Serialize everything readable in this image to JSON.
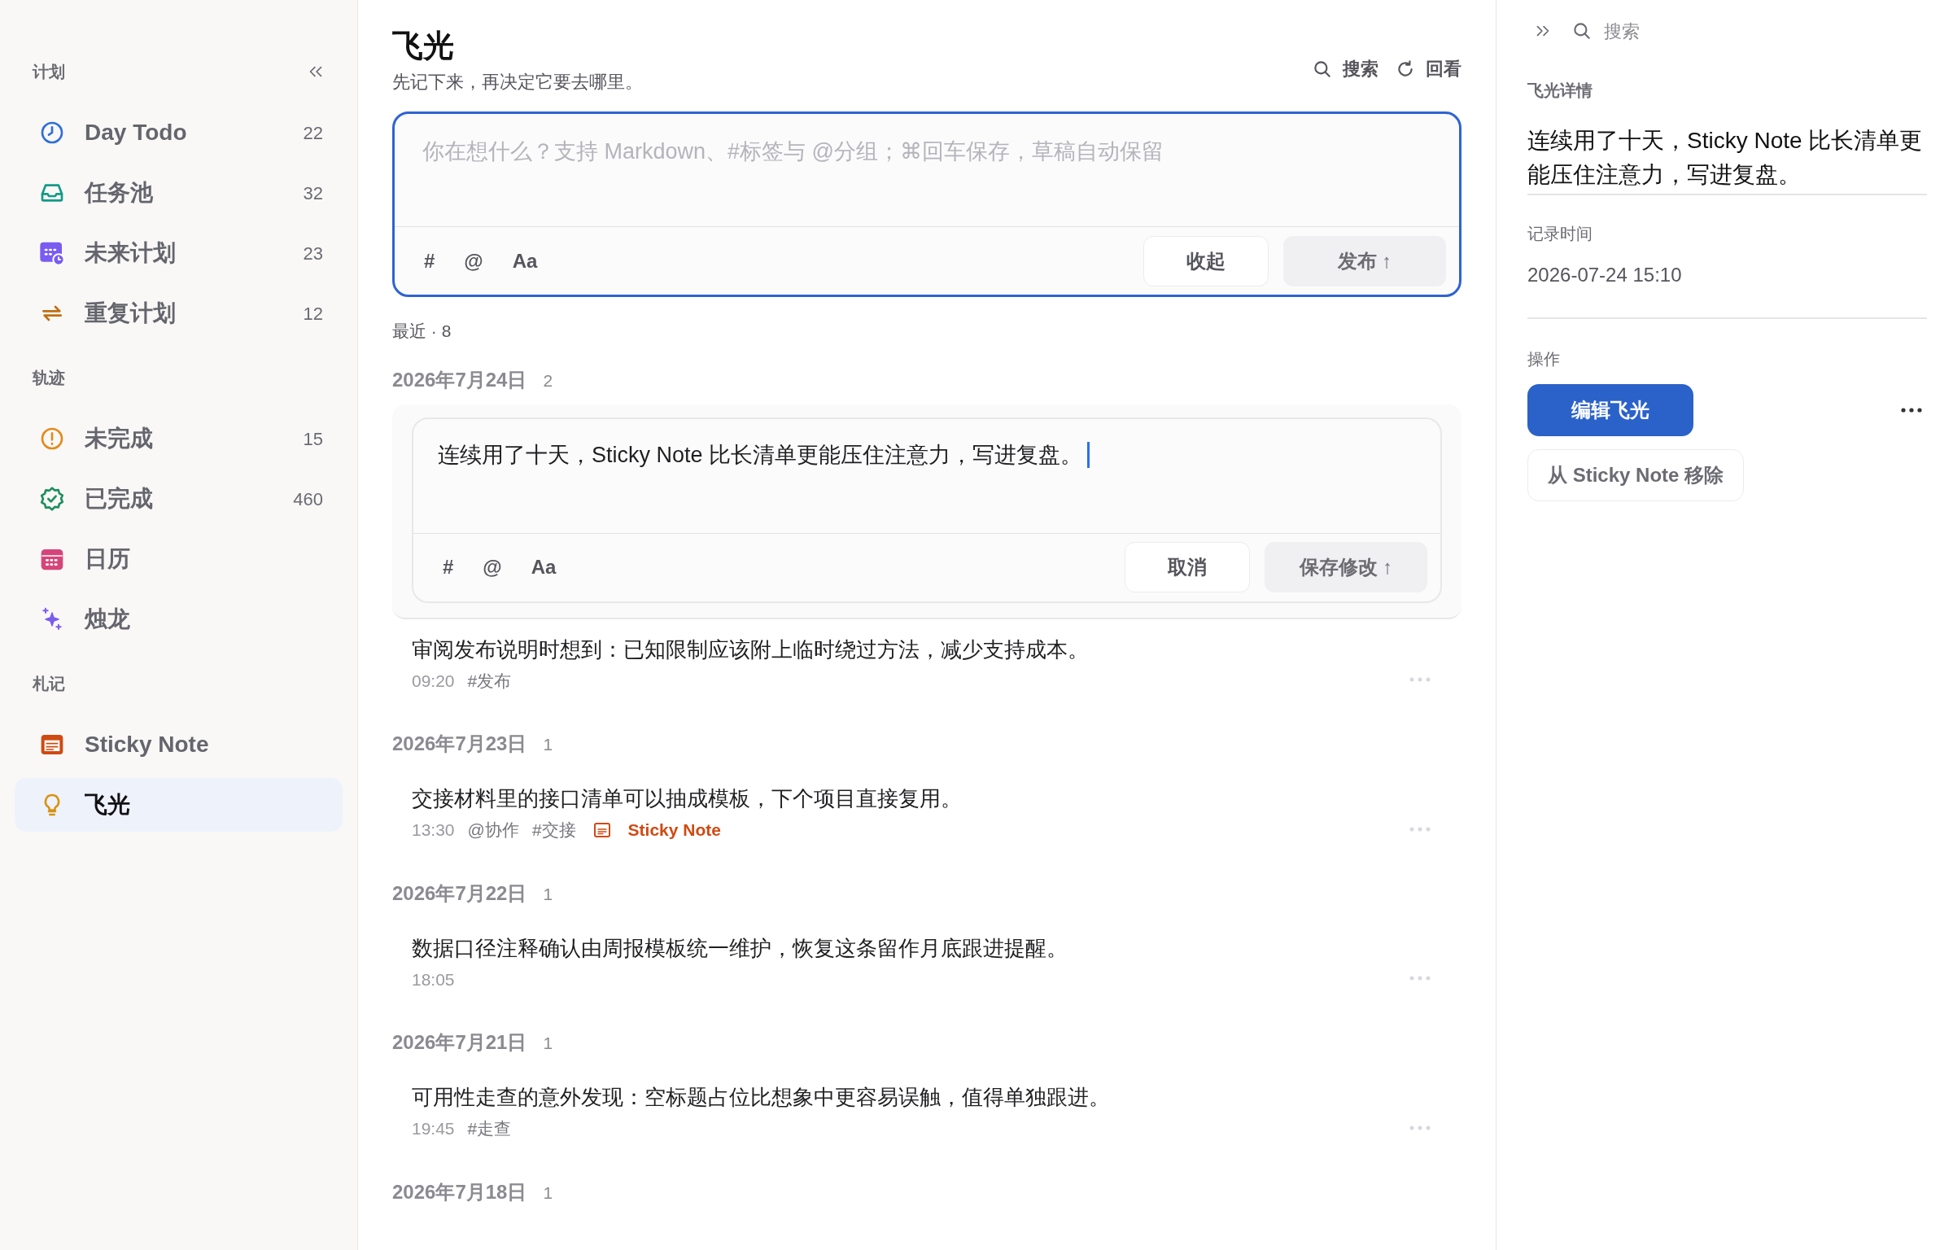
{
  "sidebar": {
    "sections": [
      {
        "title": "计划",
        "items": [
          {
            "kind": "clock",
            "label": "Day Todo",
            "count": "22",
            "selected": false
          },
          {
            "kind": "inbox",
            "label": "任务池",
            "count": "32",
            "selected": false
          },
          {
            "kind": "calendar-clock",
            "label": "未来计划",
            "count": "23",
            "selected": false
          },
          {
            "kind": "repeat",
            "label": "重复计划",
            "count": "12",
            "selected": false
          }
        ]
      },
      {
        "title": "轨迹",
        "items": [
          {
            "kind": "alert",
            "label": "未完成",
            "count": "15",
            "selected": false
          },
          {
            "kind": "badge-check",
            "label": "已完成",
            "count": "460",
            "selected": false
          },
          {
            "kind": "calendar",
            "label": "日历",
            "selected": false
          },
          {
            "kind": "sparkles",
            "label": "烛龙",
            "selected": false
          }
        ]
      },
      {
        "title": "札记",
        "items": [
          {
            "kind": "note",
            "label": "Sticky Note",
            "selected": false
          },
          {
            "kind": "bulb",
            "label": "飞光",
            "selected": true
          }
        ]
      }
    ]
  },
  "main": {
    "title": "飞光",
    "subtitle": "先记下来，再决定它要去哪里。",
    "actions": [
      {
        "kind": "search",
        "label": "搜索"
      },
      {
        "kind": "review",
        "label": "回看"
      }
    ],
    "composer": {
      "placeholder": "你在想什么？支持 Markdown、#标签与 @分组；⌘回车保存，草稿自动保留",
      "tools": [
        "#",
        "@",
        "Aa"
      ],
      "cancel": "收起",
      "submit": "发布 ↑"
    },
    "recent": "最近 · 8",
    "groups": [
      {
        "date": "2026年7月24日",
        "count": "2",
        "entries": [
          {
            "kind": "editor",
            "text": "连续用了十天，Sticky Note 比长清单更能压住注意力，写进复盘。",
            "tools": [
              "#",
              "@",
              "Aa"
            ],
            "cancel": "取消",
            "submit": "保存修改 ↑"
          },
          {
            "kind": "note",
            "text": "审阅发布说明时想到：已知限制应该附上临时绕过方法，减少支持成本。",
            "time": "09:20",
            "tags": [
              {
                "kind": "tag",
                "label": "#发布"
              }
            ]
          }
        ]
      },
      {
        "date": "2026年7月23日",
        "count": "1",
        "entries": [
          {
            "kind": "note",
            "text": "交接材料里的接口清单可以抽成模板，下个项目直接复用。",
            "time": "13:30",
            "tags": [
              {
                "kind": "tag",
                "label": "@协作"
              },
              {
                "kind": "tag",
                "label": "#交接"
              },
              {
                "kind": "link",
                "label": "Sticky Note"
              }
            ]
          }
        ]
      },
      {
        "date": "2026年7月22日",
        "count": "1",
        "entries": [
          {
            "kind": "note",
            "text": "数据口径注释确认由周报模板统一维护，恢复这条留作月底跟进提醒。",
            "time": "18:05"
          }
        ]
      },
      {
        "date": "2026年7月21日",
        "count": "1",
        "entries": [
          {
            "kind": "note",
            "text": "可用性走查的意外发现：空标题占位比想象中更容易误触，值得单独跟进。",
            "time": "19:45",
            "tags": [
              {
                "kind": "tag",
                "label": "#走查"
              }
            ]
          }
        ]
      },
      {
        "date": "2026年7月18日",
        "count": "1"
      }
    ]
  },
  "detail": {
    "search_placeholder": "搜索",
    "heading": "飞光详情",
    "text": "连续用了十天，Sticky Note 比长清单更能压住注意力，写进复盘。",
    "time_label": "记录时间",
    "time": "2026-07-24 15:10",
    "actions_label": "操作",
    "primary": "编辑飞光",
    "secondary": "从 Sticky Note 移除"
  }
}
